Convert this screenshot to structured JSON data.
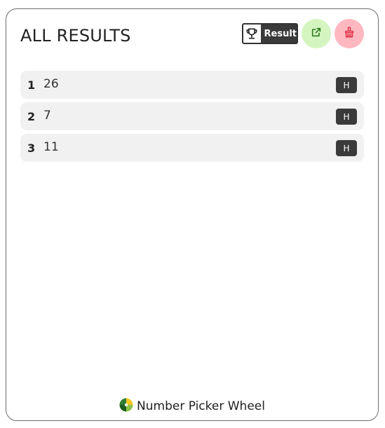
{
  "header": {
    "title": "ALL RESULTS",
    "result_button_label": "Result",
    "result_icon": "trophy-icon",
    "share_icon": "external-link-icon",
    "clear_icon": "broom-icon",
    "colors": {
      "share_bg": "#d4f5c0",
      "share_fg": "#2f7a1f",
      "clear_bg": "#ffb8c0",
      "clear_fg": "#e0344a"
    }
  },
  "results": [
    {
      "index": "1",
      "value": "26",
      "action_label": "H"
    },
    {
      "index": "2",
      "value": "7",
      "action_label": "H"
    },
    {
      "index": "3",
      "value": "11",
      "action_label": "H"
    }
  ],
  "footer": {
    "brand": "Number Picker Wheel",
    "logo_icon": "wheel-logo-icon"
  }
}
